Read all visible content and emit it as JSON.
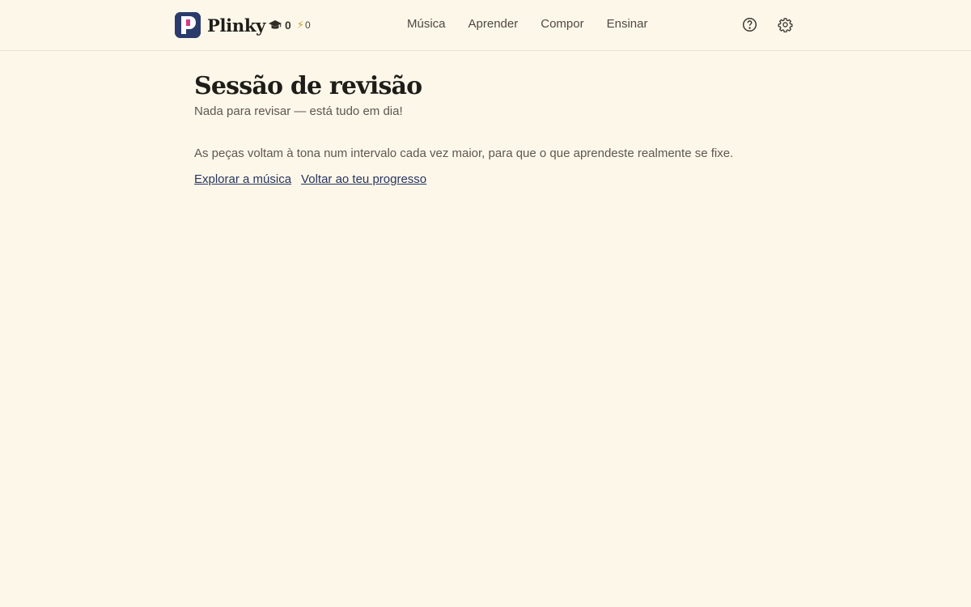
{
  "app": {
    "name": "Plinky"
  },
  "stats": {
    "graduation_count": "0",
    "energy_count": "0"
  },
  "nav": {
    "items": [
      {
        "label": "Música"
      },
      {
        "label": "Aprender"
      },
      {
        "label": "Compor"
      },
      {
        "label": "Ensinar"
      }
    ]
  },
  "icons": {
    "help": "help-circle-icon",
    "settings": "gear-icon",
    "cap": "graduation-cap-icon",
    "bolt": "lightning-bolt-icon"
  },
  "colors": {
    "background": "#fdf7ea",
    "brand": "#2b3b6b",
    "brand_accent": "#d63a8a",
    "link": "#27355f"
  },
  "page": {
    "title": "Sessão de revisão",
    "subtitle": "Nada para revisar — está tudo em dia!",
    "description": "As peças voltam à tona num intervalo cada vez maior, para que o que aprendeste realmente se fixe.",
    "links": {
      "explore": "Explorar a música",
      "progress": "Voltar ao teu progresso"
    }
  }
}
